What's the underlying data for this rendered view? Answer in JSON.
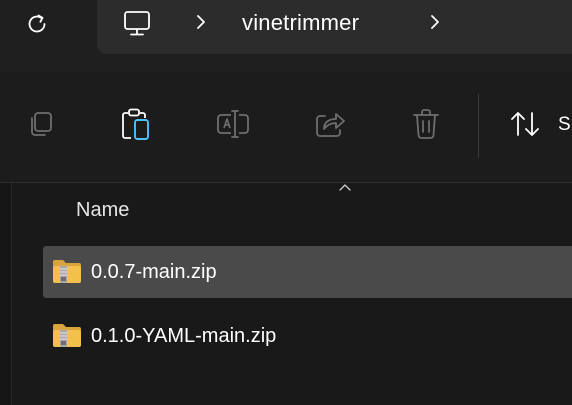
{
  "address_bar": {
    "refresh_icon": "refresh-icon",
    "pc_icon": "this-pc-icon",
    "breadcrumb": [
      "vinetrimmer"
    ]
  },
  "toolbar": {
    "buttons": [
      {
        "icon": "copy-icon",
        "label": "Copy"
      },
      {
        "icon": "paste-icon",
        "label": "Paste"
      },
      {
        "icon": "rename-icon",
        "label": "Rename"
      },
      {
        "icon": "share-icon",
        "label": "Share"
      },
      {
        "icon": "delete-icon",
        "label": "Delete"
      }
    ],
    "sort_label": "S"
  },
  "file_list": {
    "column_header": "Name",
    "files": [
      {
        "name": "0.0.7-main.zip",
        "icon": "zip-folder-icon",
        "selected": true
      },
      {
        "name": "0.1.0-YAML-main.zip",
        "icon": "zip-folder-icon",
        "selected": false
      }
    ]
  },
  "colors": {
    "background": "#191919",
    "address_bar": "#2c2c2c",
    "selection": "#4a4a4a",
    "paste_accent": "#4cc2ff",
    "folder_yellow": "#f3c04b"
  }
}
